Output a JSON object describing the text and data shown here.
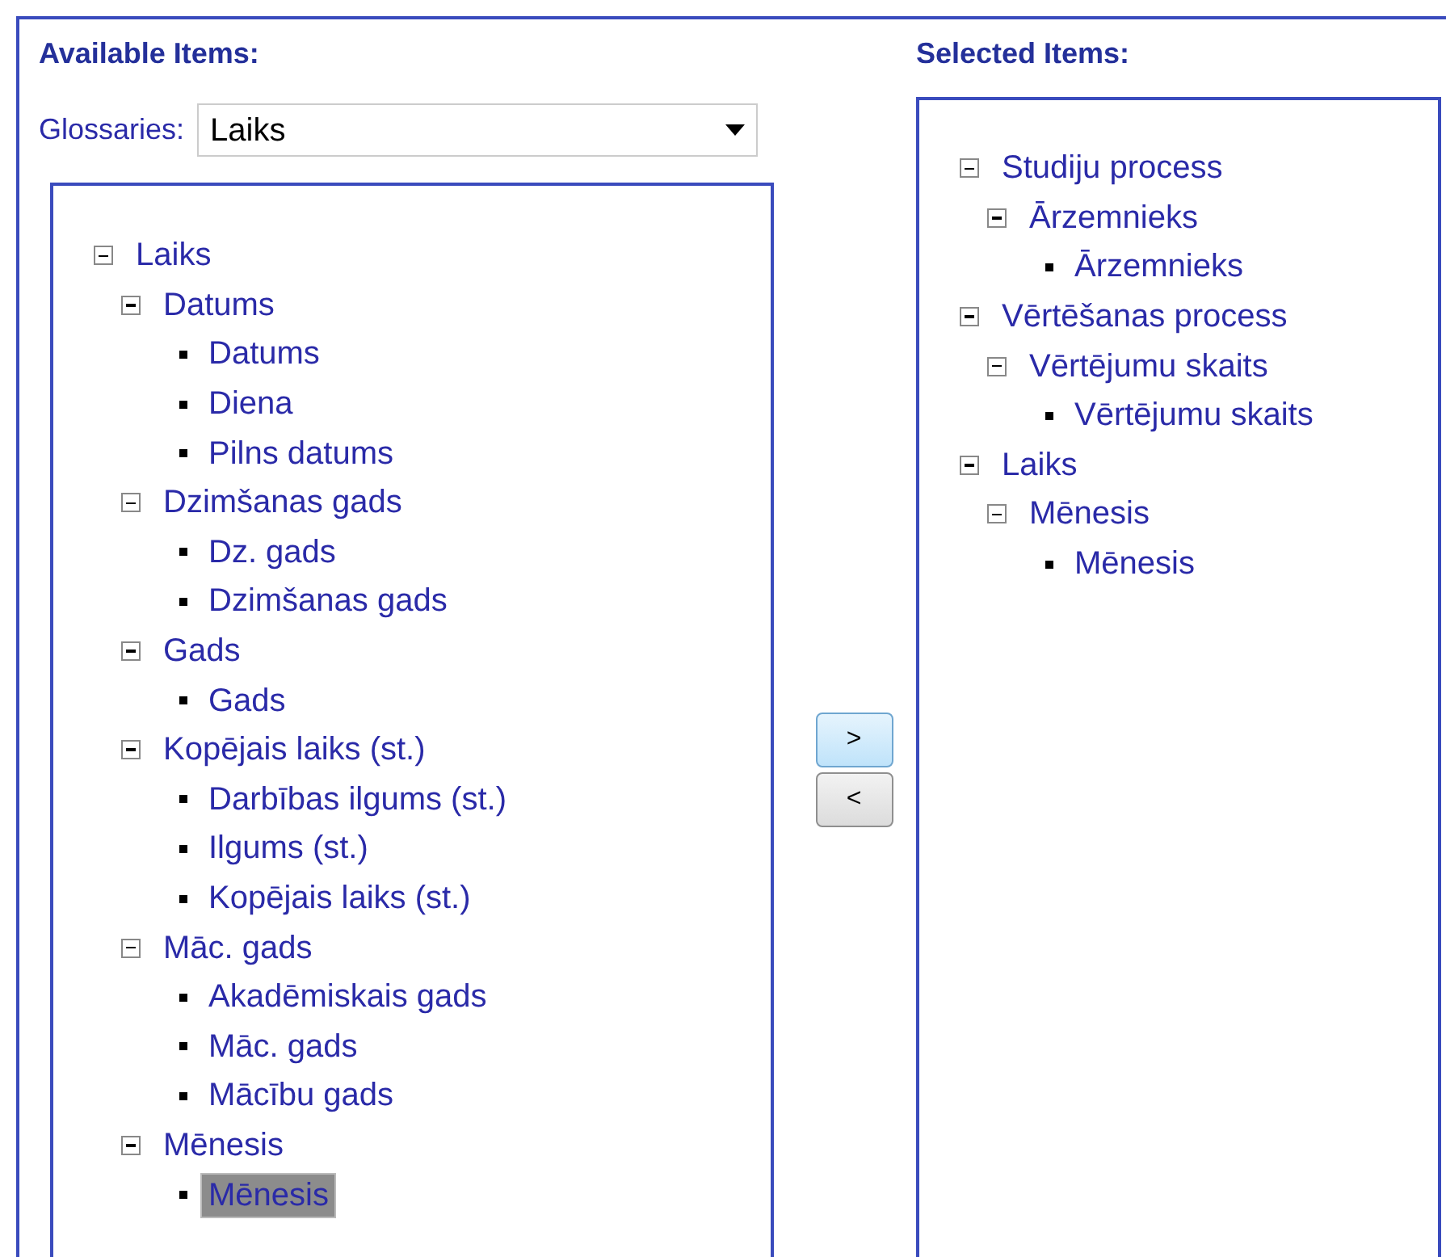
{
  "available": {
    "title": "Available Items:",
    "glossary_label": "Glossaries:",
    "glossary_value": "Laiks",
    "tree": [
      {
        "kind": "group",
        "label": "Laiks",
        "expanded": true,
        "children": [
          {
            "kind": "group",
            "label": "Datums",
            "expanded": true,
            "children": [
              {
                "kind": "leaf",
                "label": "Datums",
                "selected": false
              },
              {
                "kind": "leaf",
                "label": "Diena",
                "selected": false
              },
              {
                "kind": "leaf",
                "label": "Pilns datums",
                "selected": false
              }
            ]
          },
          {
            "kind": "group",
            "label": "Dzimšanas gads",
            "expanded": true,
            "children": [
              {
                "kind": "leaf",
                "label": "Dz. gads",
                "selected": false
              },
              {
                "kind": "leaf",
                "label": "Dzimšanas gads",
                "selected": false
              }
            ]
          },
          {
            "kind": "group",
            "label": "Gads",
            "expanded": true,
            "children": [
              {
                "kind": "leaf",
                "label": "Gads",
                "selected": false
              }
            ]
          },
          {
            "kind": "group",
            "label": "Kopējais laiks (st.)",
            "expanded": true,
            "children": [
              {
                "kind": "leaf",
                "label": "Darbības ilgums (st.)",
                "selected": false
              },
              {
                "kind": "leaf",
                "label": "Ilgums (st.)",
                "selected": false
              },
              {
                "kind": "leaf",
                "label": "Kopējais laiks (st.)",
                "selected": false
              }
            ]
          },
          {
            "kind": "group",
            "label": "Māc. gads",
            "expanded": true,
            "children": [
              {
                "kind": "leaf",
                "label": "Akadēmiskais gads",
                "selected": false
              },
              {
                "kind": "leaf",
                "label": "Māc. gads",
                "selected": false
              },
              {
                "kind": "leaf",
                "label": "Mācību gads",
                "selected": false
              }
            ]
          },
          {
            "kind": "group",
            "label": "Mēnesis",
            "expanded": true,
            "children": [
              {
                "kind": "leaf",
                "label": "Mēnesis",
                "selected": true
              }
            ]
          }
        ]
      }
    ]
  },
  "buttons": [
    {
      "label": ">",
      "highlighted": true
    },
    {
      "label": "<",
      "highlighted": false
    }
  ],
  "selected": {
    "title": "Selected Items:",
    "tree": [
      {
        "kind": "group",
        "label": "Studiju process",
        "expanded": true,
        "children": [
          {
            "kind": "group",
            "label": "Ārzemnieks",
            "expanded": true,
            "children": [
              {
                "kind": "leaf",
                "label": "Ārzemnieks",
                "selected": false
              }
            ]
          }
        ]
      },
      {
        "kind": "group",
        "label": "Vērtēšanas process",
        "expanded": true,
        "children": [
          {
            "kind": "group",
            "label": "Vērtējumu skaits",
            "expanded": true,
            "children": [
              {
                "kind": "leaf",
                "label": "Vērtējumu skaits",
                "selected": false
              }
            ]
          }
        ]
      },
      {
        "kind": "group",
        "label": "Laiks",
        "expanded": true,
        "children": [
          {
            "kind": "group",
            "label": "Mēnesis",
            "expanded": true,
            "children": [
              {
                "kind": "leaf",
                "label": "Mēnesis",
                "selected": false
              }
            ]
          }
        ]
      }
    ]
  }
}
